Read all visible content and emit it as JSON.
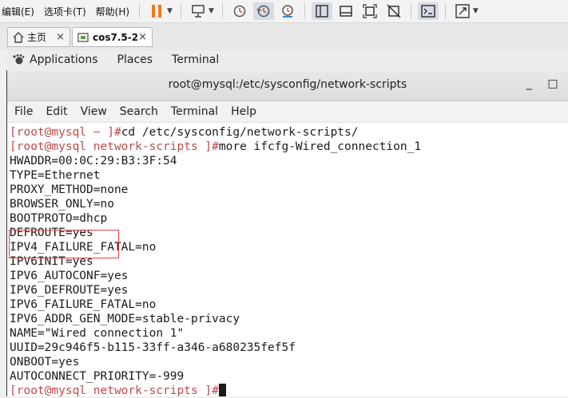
{
  "vmware": {
    "menus": [
      "编辑(E)",
      "选项卡(T)",
      "帮助(H)"
    ],
    "tabs": [
      {
        "label": "主页"
      },
      {
        "label": "cos7.5-2",
        "close": "×"
      }
    ]
  },
  "gnome": {
    "applications": "Applications",
    "places": "Places",
    "terminal": "Terminal"
  },
  "window": {
    "title": "root@mysql:/etc/sysconfig/network-scripts",
    "minimize": "_",
    "maximize": "□"
  },
  "term_menu": [
    "File",
    "Edit",
    "View",
    "Search",
    "Terminal",
    "Help"
  ],
  "terminal": {
    "lines": [
      {
        "prompt": "[root@mysql ~ ]#",
        "cmd": "cd /etc/sysconfig/network-scripts/"
      },
      {
        "prompt": "[root@mysql network-scripts ]#",
        "cmd": "more ifcfg-Wired_connection_1"
      },
      {
        "text": "HWADDR=00:0C:29:B3:3F:54"
      },
      {
        "text": "TYPE=Ethernet"
      },
      {
        "text": "PROXY_METHOD=none"
      },
      {
        "text": "BROWSER_ONLY=no"
      },
      {
        "text": "BOOTPROTO=dhcp"
      },
      {
        "text": "DEFROUTE=yes"
      },
      {
        "text": "IPV4_FAILURE_FATAL=no"
      },
      {
        "text": "IPV6INIT=yes"
      },
      {
        "text": "IPV6_AUTOCONF=yes"
      },
      {
        "text": "IPV6_DEFROUTE=yes"
      },
      {
        "text": "IPV6_FAILURE_FATAL=no"
      },
      {
        "text": "IPV6_ADDR_GEN_MODE=stable-privacy"
      },
      {
        "text": "NAME=\"Wired connection 1\""
      },
      {
        "text": "UUID=29c946f5-b115-33ff-a346-a680235fef5f"
      },
      {
        "text": "ONBOOT=yes"
      },
      {
        "text": "AUTOCONNECT_PRIORITY=-999"
      },
      {
        "prompt": "[root@mysql network-scripts ]#",
        "cmd": ""
      }
    ]
  },
  "colors": {
    "prompt": "#ba4b4b",
    "highlight_border": "#e34444",
    "pause_icon": "#f07820"
  }
}
